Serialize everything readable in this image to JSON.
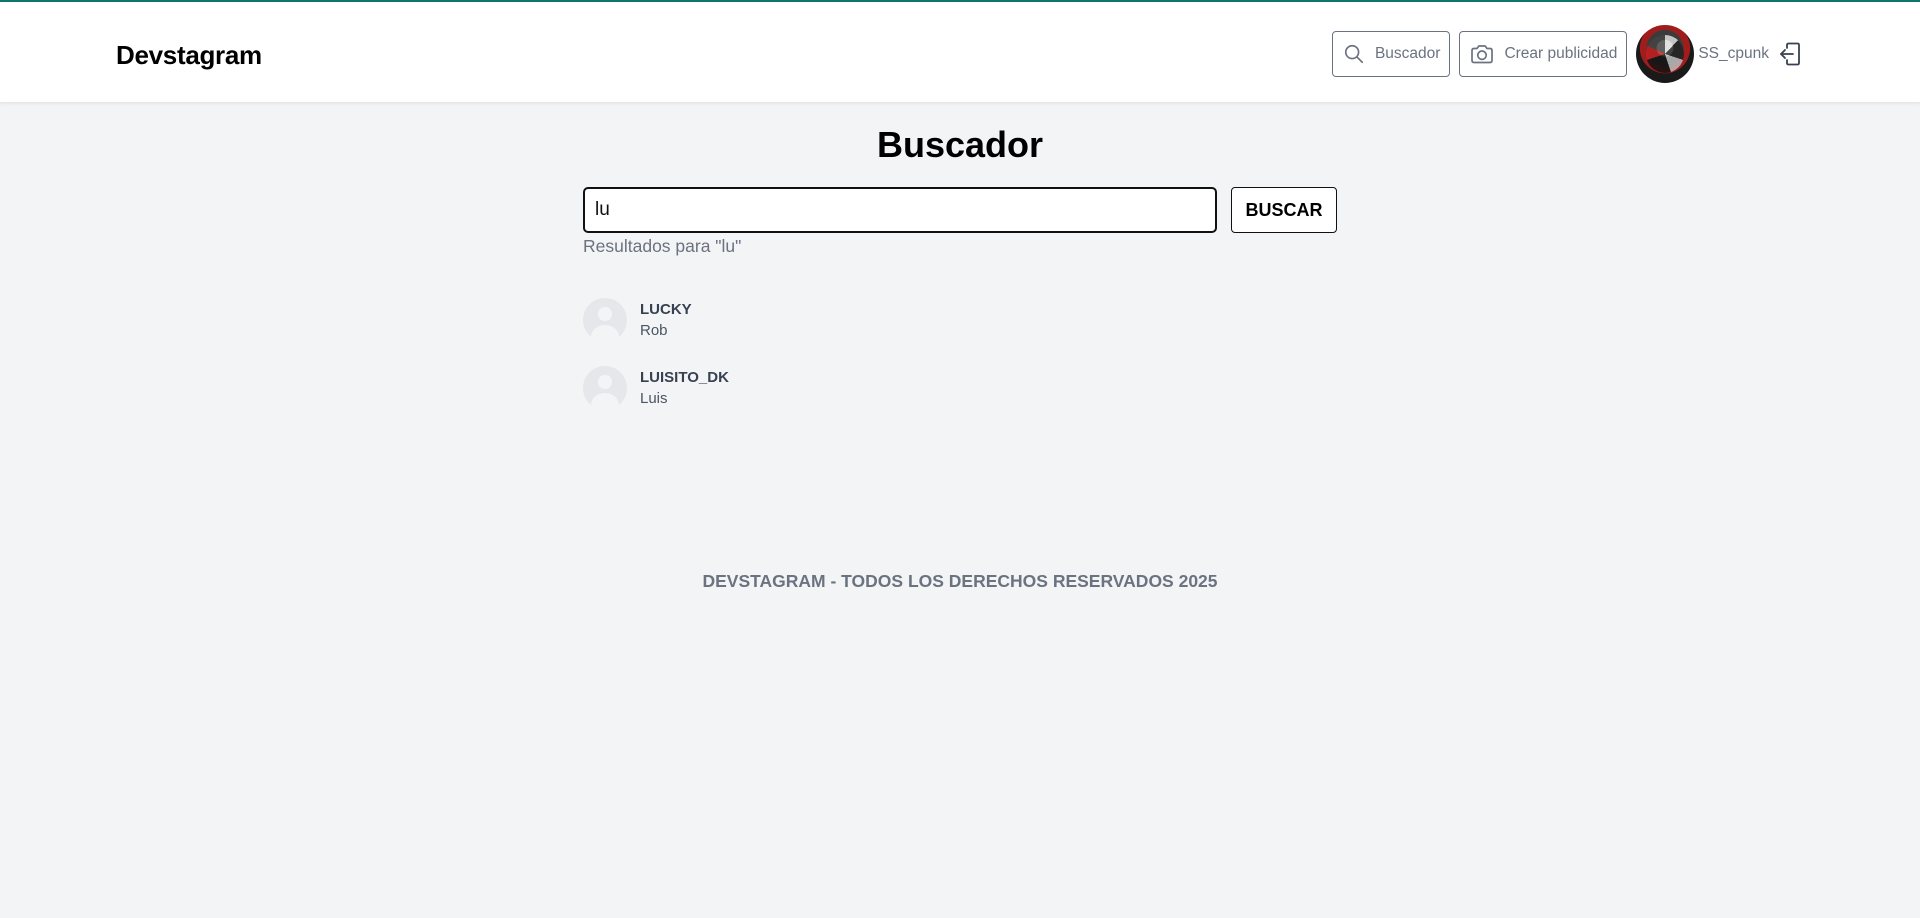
{
  "app": {
    "logo": "Devstagram"
  },
  "nav": {
    "search_label": "Buscador",
    "create_label": "Crear publicidad",
    "username": "SS_cpunk"
  },
  "icons": {
    "search": "search-icon",
    "camera": "camera-icon",
    "logout": "logout-icon",
    "avatar": "user-avatar",
    "default_avatar": "default-avatar-icon"
  },
  "page": {
    "title": "Buscador",
    "search_value": "lu",
    "search_button": "BUSCAR",
    "results_label": "Resultados para \"lu\""
  },
  "results": [
    {
      "username": "LUCKY",
      "name": "Rob"
    },
    {
      "username": "LUISITO_DK",
      "name": "Luis"
    }
  ],
  "footer": {
    "text": "DEVSTAGRAM - TODOS LOS DERECHOS RESERVADOS 2025"
  },
  "colors": {
    "accent_strip": "#0f766e",
    "background": "#f3f4f6",
    "muted_text": "#6b7280"
  }
}
